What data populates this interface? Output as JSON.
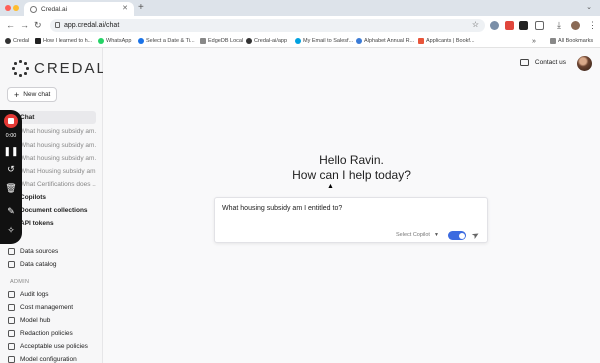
{
  "browser": {
    "tab_title": "Credal.ai",
    "new_tab": "+",
    "url": "app.credal.ai/chat",
    "bookmarks": [
      "Credal",
      "How I learned to h...",
      "WhatsApp",
      "Select a Date & Ti...",
      "EdgeDB Local",
      "Credal-ai/app",
      "My Email to Salesf...",
      "Alphabet Annual R...",
      "Applicants | Bookf..."
    ],
    "bookmarks_more": "»",
    "all_bookmarks": "All Bookmarks"
  },
  "sidebar": {
    "logo_text": "CREDAL",
    "new_chat": "New chat",
    "chat_label": "Chat",
    "history": [
      "What housing subsidy am...",
      "What housing subsidy am...",
      "What housing subsidy am...",
      "What Housing subsidy am...",
      "What Certifications does ..."
    ],
    "copilots": "Copilots",
    "document_collections": "Document collections",
    "api_tokens": "API tokens",
    "data_items": [
      "Data sources",
      "Data catalog"
    ],
    "admin_label": "ADMIN",
    "admin_items": [
      "Audit logs",
      "Cost management",
      "Model hub",
      "Redaction policies",
      "Acceptable use policies",
      "Model configuration"
    ]
  },
  "recorder": {
    "time": "0:00"
  },
  "header": {
    "contact_us": "Contact us"
  },
  "main": {
    "greeting_line1": "Hello Ravin.",
    "greeting_line2": "How can I help today?",
    "input_value": "What housing subsidy am I entitled to?",
    "copilot_select": "Select Copilot"
  },
  "colors": {
    "accent": "#3c6be0",
    "record": "#e53935"
  }
}
